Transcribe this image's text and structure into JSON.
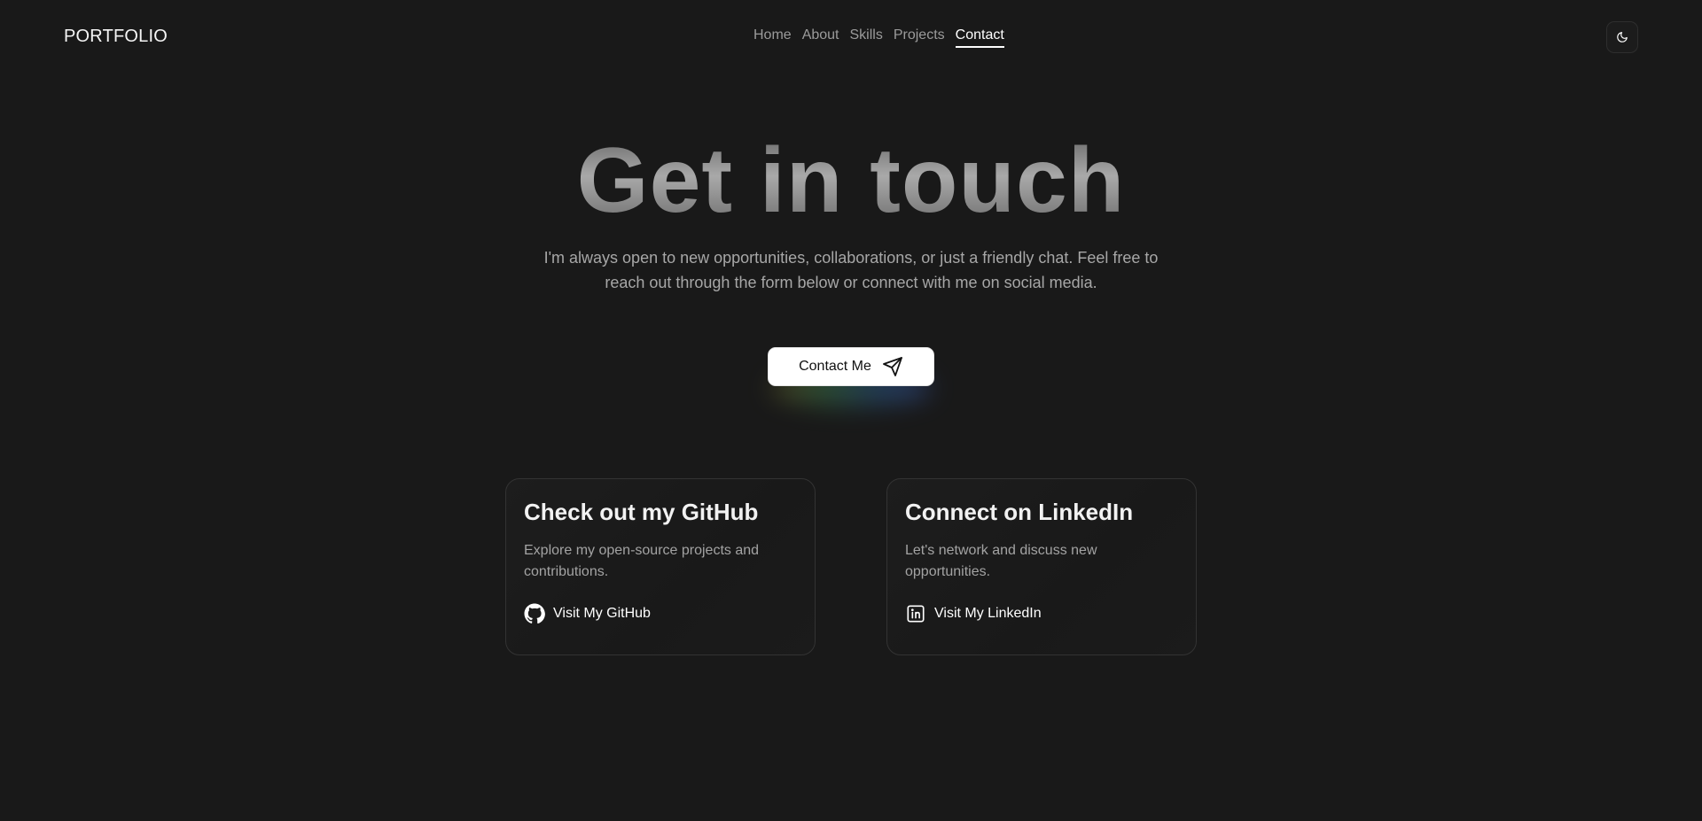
{
  "header": {
    "brand": "PORTFOLIO",
    "nav": [
      {
        "label": "Home",
        "active": false
      },
      {
        "label": "About",
        "active": false
      },
      {
        "label": "Skills",
        "active": false
      },
      {
        "label": "Projects",
        "active": false
      },
      {
        "label": "Contact",
        "active": true
      }
    ],
    "theme_toggle_icon": "moon-icon"
  },
  "hero": {
    "title": "Get in touch",
    "subtitle": "I'm always open to new opportunities, collaborations, or just a friendly chat. Feel free to reach out through the form below or connect with me on social media.",
    "button_label": "Contact Me",
    "button_icon": "send-icon"
  },
  "cards": {
    "github": {
      "title": "Check out my GitHub",
      "description": "Explore my open-source projects and contributions.",
      "link_label": "Visit My GitHub",
      "icon": "github-icon"
    },
    "linkedin": {
      "title": "Connect on LinkedIn",
      "description": "Let's network and discuss new opportunities.",
      "link_label": "Visit My LinkedIn",
      "icon": "linkedin-icon"
    }
  },
  "colors": {
    "background": "#191919",
    "text": "#ffffff",
    "muted": "#a7a7a7",
    "card_border": "#333333"
  }
}
